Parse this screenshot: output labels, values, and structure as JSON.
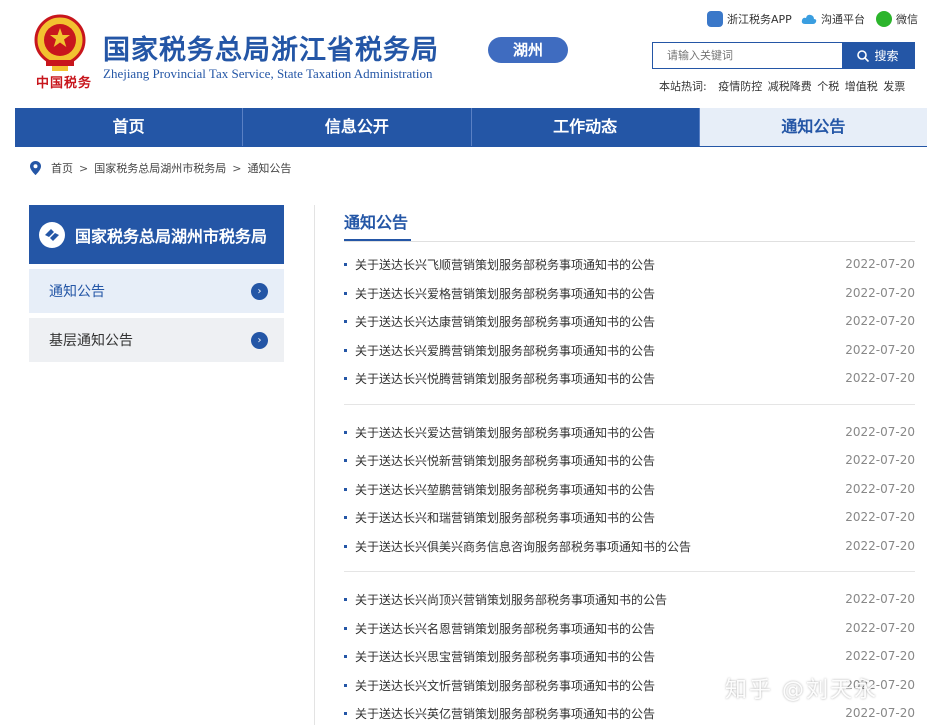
{
  "header": {
    "emblem_text": "中国税务",
    "title": "国家税务总局浙江省税务局",
    "subtitle": "Zhejiang Provincial Tax Service, State Taxation Administration",
    "city_badge": "湖州",
    "top_links": [
      {
        "label": "浙江税务APP",
        "icon": "phone-app-icon",
        "color": "#3a78c9"
      },
      {
        "label": "沟通平台",
        "icon": "cloud-icon",
        "color": "#3a9ee0"
      },
      {
        "label": "微信",
        "icon": "wechat-icon",
        "color": "#2cb52c"
      }
    ],
    "search": {
      "placeholder": "请输入关键词",
      "button_label": "搜索"
    },
    "hot_words_label": "本站热词:",
    "hot_words": [
      "疫情防控",
      "减税降费",
      "个税",
      "增值税",
      "发票"
    ]
  },
  "nav": {
    "items": [
      {
        "label": "首页",
        "active": false
      },
      {
        "label": "信息公开",
        "active": false
      },
      {
        "label": "工作动态",
        "active": false
      },
      {
        "label": "通知公告",
        "active": true
      }
    ]
  },
  "breadcrumb": {
    "items": [
      "首页",
      "国家税务总局湖州市税务局",
      "通知公告"
    ],
    "separator": ">"
  },
  "sidebar": {
    "title": "国家税务总局湖州市税务局",
    "items": [
      {
        "label": "通知公告",
        "active": true
      },
      {
        "label": "基层通知公告",
        "active": false
      }
    ]
  },
  "main": {
    "title": "通知公告",
    "groups": [
      [
        {
          "title": "关于送达长兴飞顺营销策划服务部税务事项通知书的公告",
          "date": "2022-07-20"
        },
        {
          "title": "关于送达长兴爱格营销策划服务部税务事项通知书的公告",
          "date": "2022-07-20"
        },
        {
          "title": "关于送达长兴达康营销策划服务部税务事项通知书的公告",
          "date": "2022-07-20"
        },
        {
          "title": "关于送达长兴爱腾营销策划服务部税务事项通知书的公告",
          "date": "2022-07-20"
        },
        {
          "title": "关于送达长兴悦腾营销策划服务部税务事项通知书的公告",
          "date": "2022-07-20"
        }
      ],
      [
        {
          "title": "关于送达长兴爱达营销策划服务部税务事项通知书的公告",
          "date": "2022-07-20"
        },
        {
          "title": "关于送达长兴悦新营销策划服务部税务事项通知书的公告",
          "date": "2022-07-20"
        },
        {
          "title": "关于送达长兴堃鹏营销策划服务部税务事项通知书的公告",
          "date": "2022-07-20"
        },
        {
          "title": "关于送达长兴和瑞营销策划服务部税务事项通知书的公告",
          "date": "2022-07-20"
        },
        {
          "title": "关于送达长兴俱美兴商务信息咨询服务部税务事项通知书的公告",
          "date": "2022-07-20"
        }
      ],
      [
        {
          "title": "关于送达长兴尚顶兴营销策划服务部税务事项通知书的公告",
          "date": "2022-07-20"
        },
        {
          "title": "关于送达长兴名恩营销策划服务部税务事项通知书的公告",
          "date": "2022-07-20"
        },
        {
          "title": "关于送达长兴思宝营销策划服务部税务事项通知书的公告",
          "date": "2022-07-20"
        },
        {
          "title": "关于送达长兴文忻营销策划服务部税务事项通知书的公告",
          "date": "2022-07-20"
        },
        {
          "title": "关于送达长兴英亿营销策划服务部税务事项通知书的公告",
          "date": "2022-07-20"
        }
      ]
    ]
  },
  "watermark": "知乎 @刘天永",
  "colors": {
    "brand_blue": "#2456a6",
    "badge_blue": "#3f6cc0",
    "emblem_red": "#c8161d"
  }
}
